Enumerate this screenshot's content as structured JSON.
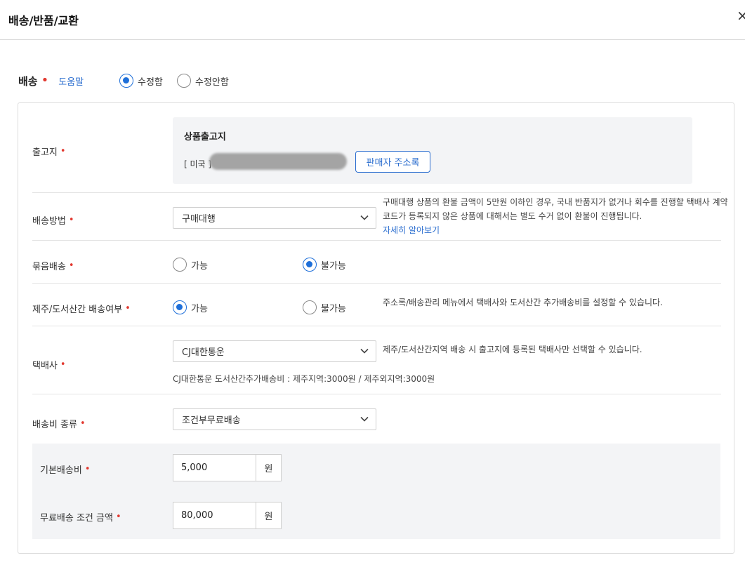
{
  "header": {
    "title": "배송/반품/교환",
    "close_icon": "×"
  },
  "section": {
    "title": "배송",
    "required_mark": "•",
    "help_link": "도움말",
    "edit_options": [
      {
        "label": "수정함",
        "selected": true
      },
      {
        "label": "수정안함",
        "selected": false
      }
    ]
  },
  "warehouse": {
    "label": "출고지",
    "box_title": "상품출고지",
    "country": "[ 미국 ]",
    "address_book_button": "판매자 주소록"
  },
  "shipping_method": {
    "label": "배송방법",
    "value": "구매대행",
    "note": "구매대행 상품의 환불 금액이 5만원 이하인 경우, 국내 반품지가 없거나 회수를 진행할 택배사 계약 코드가 등록되지 않은 상품에 대해서는 별도 수거 없이 환불이 진행됩니다.",
    "note_link": "자세히 알아보기"
  },
  "bundle_shipping": {
    "label": "묶음배송",
    "options": [
      {
        "label": "가능",
        "selected": false
      },
      {
        "label": "불가능",
        "selected": true
      }
    ]
  },
  "island_shipping": {
    "label": "제주/도서산간 배송여부",
    "options": [
      {
        "label": "가능",
        "selected": true
      },
      {
        "label": "불가능",
        "selected": false
      }
    ],
    "note": "주소록/배송관리 메뉴에서 택배사와 도서산간 추가배송비를 설정할 수 있습니다."
  },
  "courier": {
    "label": "택배사",
    "value": "CJ대한통운",
    "note": "제주/도서산간지역 배송 시 출고지에 등록된 택배사만 선택할 수 있습니다.",
    "extra_fee_note": "CJ대한통운 도서산간추가배송비 : 제주지역:3000원 / 제주외지역:3000원"
  },
  "fee_type": {
    "label": "배송비 종류",
    "value": "조건부무료배송"
  },
  "base_fee": {
    "label": "기본배송비",
    "value": "5,000",
    "unit": "원"
  },
  "free_condition": {
    "label": "무료배송 조건 금액",
    "value": "80,000",
    "unit": "원"
  },
  "colors": {
    "accent": "#1e6fd9",
    "required": "#e2382f",
    "link": "#2a6dcf"
  }
}
